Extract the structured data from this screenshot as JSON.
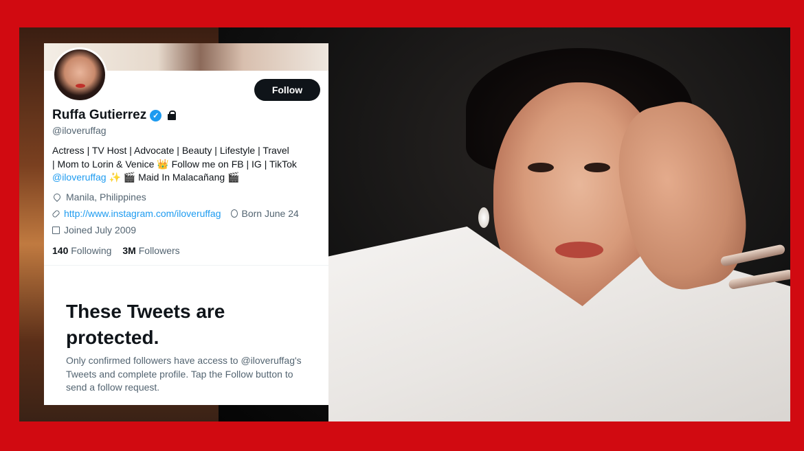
{
  "colors": {
    "frame": "#d10a11",
    "follow_bg": "#0f1419",
    "link": "#1d9bf0",
    "muted": "#536471"
  },
  "profile": {
    "follow_label": "Follow",
    "name": "Ruffa Gutierrez",
    "verified_icon": "verified-badge-icon",
    "protected_icon": "lock-icon",
    "handle": "@iloveruffag",
    "bio_line1": "Actress | TV Host | Advocate | Beauty | Lifestyle | Travel",
    "bio_line2": "| Mom to Lorin & Venice 👑 Follow me on FB | IG | TikTok",
    "bio_mention": "@iloveruffag",
    "bio_line3_rest": " ✨ 🎬 Maid In Malacañang 🎬",
    "location": "Manila, Philippines",
    "url": "http://www.instagram.com/iloveruffag",
    "birthday": "Born June 24",
    "joined": "Joined July 2009",
    "following_count": "140",
    "following_label": "Following",
    "followers_count": "3M",
    "followers_label": "Followers"
  },
  "protected": {
    "title": "These Tweets are protected.",
    "message": "Only confirmed followers have access to @iloveruffag's Tweets and complete profile. Tap the Follow button to send a follow request."
  }
}
